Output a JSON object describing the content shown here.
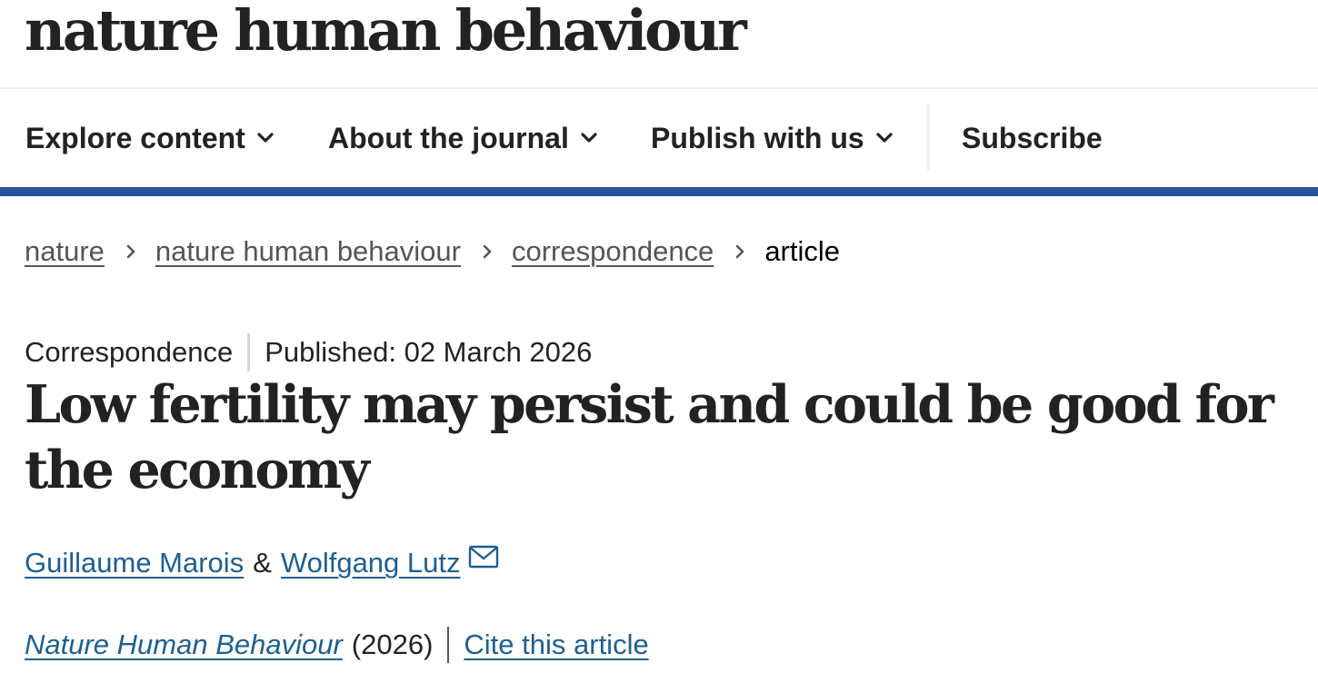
{
  "site": {
    "logo": "nature human behaviour"
  },
  "nav": {
    "items": [
      {
        "label": "Explore content",
        "icon": "chevron-down-icon"
      },
      {
        "label": "About the journal",
        "icon": "chevron-down-icon"
      },
      {
        "label": "Publish with us",
        "icon": "chevron-down-icon"
      }
    ],
    "subscribe": "Subscribe"
  },
  "breadcrumb": {
    "items": [
      "nature",
      "nature human behaviour",
      "correspondence"
    ],
    "current": "article",
    "separator_icon": "chevron-right-icon"
  },
  "article": {
    "type": "Correspondence",
    "published": "Published: 02 March 2026",
    "title": "Low fertility may persist and could be good for the economy",
    "authors": [
      "Guillaume Marois",
      "Wolfgang Lutz"
    ],
    "author_joiner": "&",
    "contact_icon": "mail-icon",
    "journal": "Nature Human Behaviour",
    "year": "(2026)",
    "cite": "Cite this article"
  },
  "colors": {
    "accent_bar": "#29539b",
    "link": "#1e5f91",
    "text": "#222222"
  }
}
